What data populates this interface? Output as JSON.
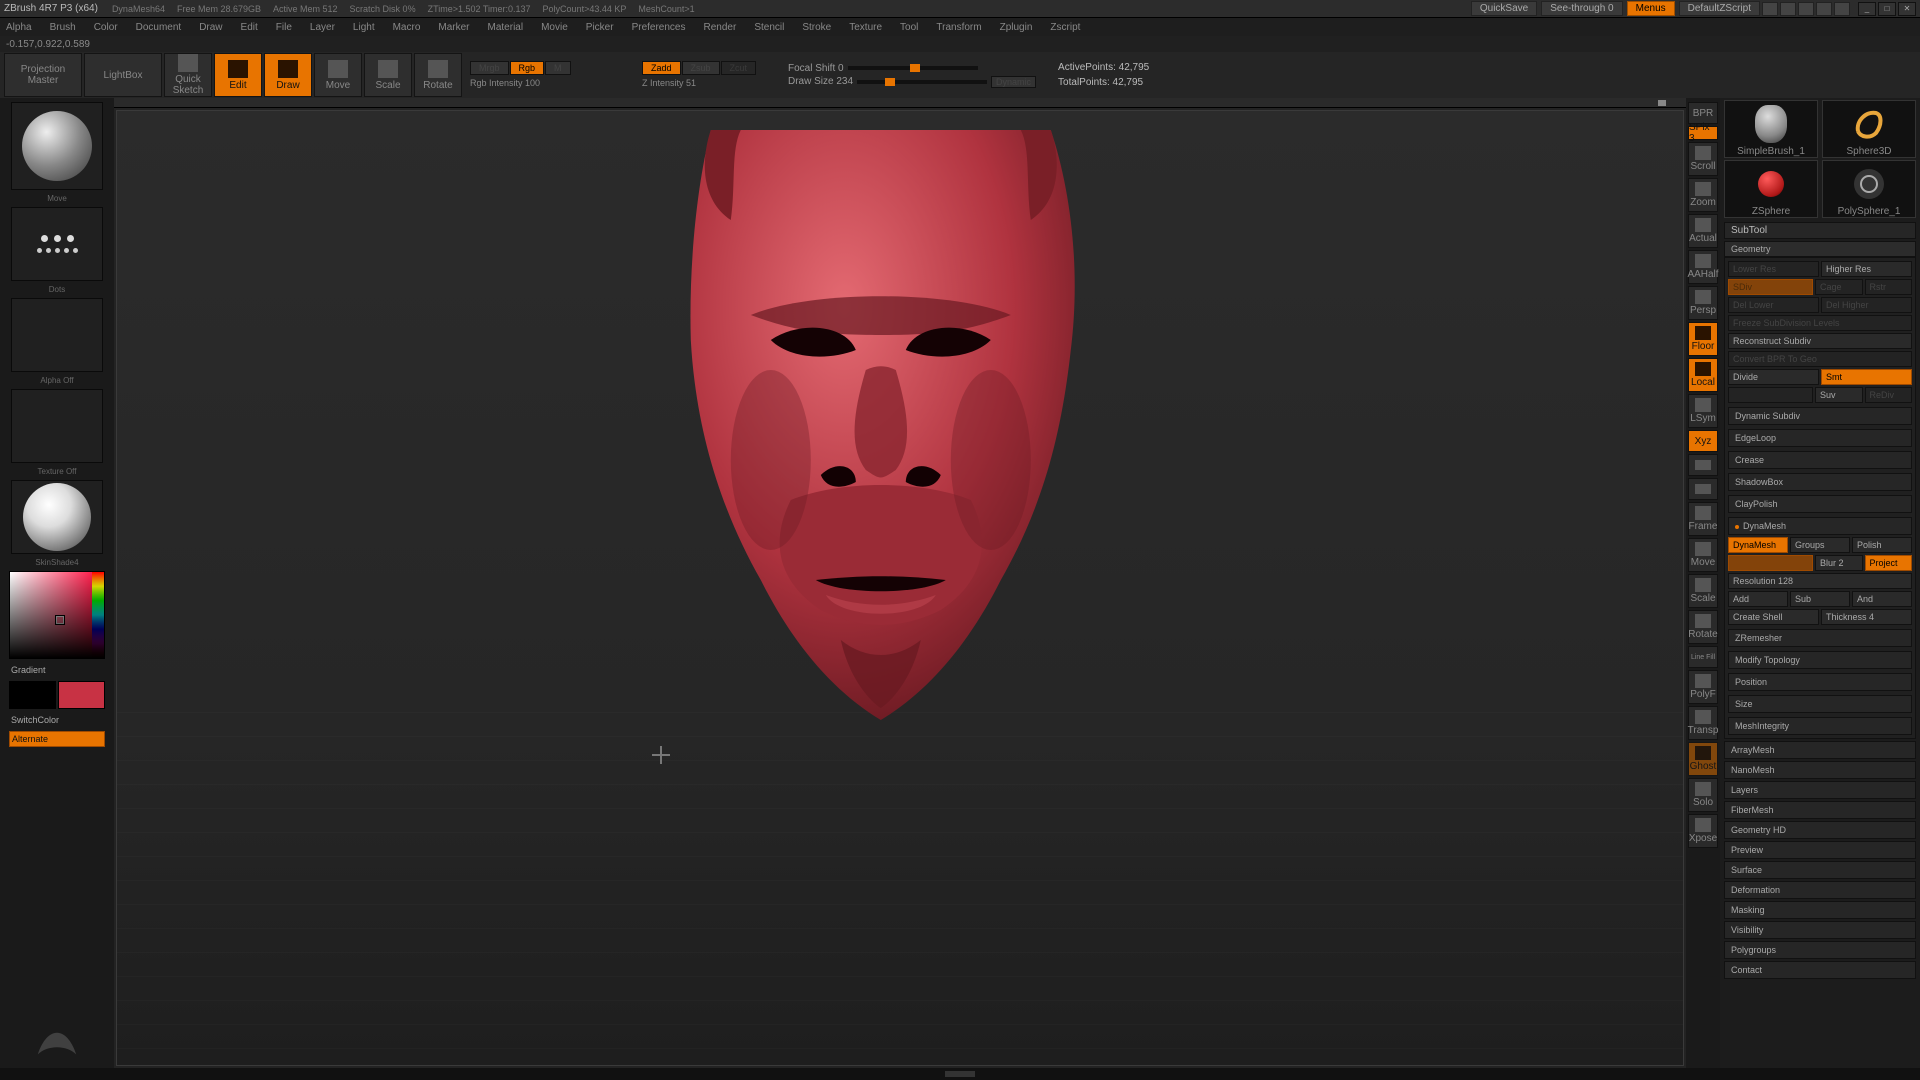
{
  "title": {
    "app": "ZBrush 4R7 P3 (x64)",
    "tool": "DynaMesh64",
    "stats": [
      "Free Mem 28.679GB",
      "Active Mem 512",
      "Scratch Disk 0%",
      "ZTime>1.502 Timer:0.137",
      "PolyCount>43.44 KP",
      "MeshCount>1"
    ],
    "quicksave": "QuickSave",
    "seethrough": "See-through  0",
    "menus": "Menus",
    "ui": "DefaultZScript"
  },
  "menus": [
    "Alpha",
    "Brush",
    "Color",
    "Document",
    "Draw",
    "Edit",
    "File",
    "Layer",
    "Light",
    "Macro",
    "Marker",
    "Material",
    "Movie",
    "Picker",
    "Preferences",
    "Render",
    "Stencil",
    "Stroke",
    "Texture",
    "Tool",
    "Transform",
    "Zplugin",
    "Zscript"
  ],
  "info": "-0.157,0.922,0.589",
  "shelf": {
    "projection": "Projection Master",
    "lightbox": "LightBox",
    "quicksketch": "Quick Sketch",
    "edit": "Edit",
    "draw": "Draw",
    "move": "Move",
    "scale": "Scale",
    "rotate": "Rotate",
    "mrgb": "Mrgb",
    "rgb": "Rgb",
    "m": "M",
    "rgb_int": "Rgb Intensity 100",
    "zadd": "Zadd",
    "zsub": "Zsub",
    "zcut": "Zcut",
    "z_int": "Z Intensity 51",
    "focal": "Focal Shift 0",
    "draw_size": "Draw Size 234",
    "dynamic": "Dynamic",
    "active": "ActivePoints: 42,795",
    "total": "TotalPoints: 42,795"
  },
  "left": {
    "brush": "Move",
    "stroke": "Dots",
    "alpha": "Alpha Off",
    "texture": "Texture Off",
    "material": "SkinShade4",
    "gradient": "Gradient",
    "switch": "SwitchColor",
    "alternate": "Alternate"
  },
  "vtools": [
    "BPR",
    "SPix 3",
    "Scroll",
    "Zoom",
    "Actual",
    "AAHalf",
    "Persp",
    "Floor",
    "Local",
    "LSym",
    "Xyz",
    "",
    "",
    "Frame",
    "Move",
    "Scale",
    "Rotate",
    "PolyF",
    "Transp",
    "Ghost",
    "Solo",
    "Xpose"
  ],
  "right": {
    "thumbs": [
      {
        "label": "SimpleBrush_1"
      },
      {
        "label": "Sphere3D"
      },
      {
        "label": "ZSphere"
      },
      {
        "label": "PolySphere_1"
      }
    ],
    "subtool": "SubTool",
    "geometry": "Geometry",
    "lower": "Lower Res",
    "higher": "Higher Res",
    "sdiv": "SDiv",
    "cage": "Cage",
    "rstr": "Rstr",
    "del_lower": "Del Lower",
    "del_higher": "Del Higher",
    "freeze": "Freeze SubDivision Levels",
    "recon": "Reconstruct Subdiv",
    "convert": "Convert BPR To Geo",
    "divide": "Divide",
    "smt": "Smt",
    "suv": "Suv",
    "rediv": "ReDiv",
    "dynsub": "Dynamic Subdiv",
    "edgeloop": "EdgeLoop",
    "crease": "Crease",
    "shadowbox": "ShadowBox",
    "claypolish": "ClayPolish",
    "dynamesh_sec": "DynaMesh",
    "dynamesh": "DynaMesh",
    "groups": "Groups",
    "polish": "Polish",
    "blur": "Blur 2",
    "project": "Project",
    "resolution": "Resolution 128",
    "add": "Add",
    "sub": "Sub",
    "and": "And",
    "shell": "Create Shell",
    "thickness": "Thickness 4",
    "sections": [
      "ZRemesher",
      "Modify Topology",
      "Position",
      "Size",
      "MeshIntegrity",
      "ArrayMesh",
      "NanoMesh",
      "Layers",
      "FiberMesh",
      "Geometry HD",
      "Preview",
      "Surface",
      "Deformation",
      "Masking",
      "Visibility",
      "Polygroups",
      "Contact"
    ]
  }
}
